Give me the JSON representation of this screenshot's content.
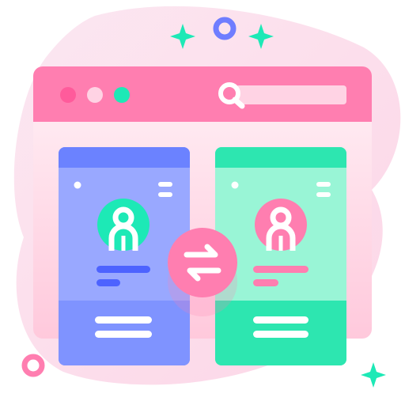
{
  "illustration": {
    "subject": "profile-swap-browser-window",
    "colors": {
      "pink": "#ff7eb0",
      "pink_light": "#ffd3e4",
      "blob": "#fde2ef",
      "blue_card": "#99a8ff",
      "blue_header": "#6b82ff",
      "blue_footer": "#7f93ff",
      "green_card": "#99f5d6",
      "green_header": "#2de6b0",
      "green_footer": "#2de6b0",
      "teal_dot": "#1de9b6",
      "violet_ring": "#6f7dff",
      "white": "#ffffff"
    },
    "icons": [
      "sparkle-icon",
      "ring-icon",
      "window-dot-icon",
      "search-icon",
      "menu-icon",
      "avatar-icon",
      "swap-arrows-icon"
    ]
  }
}
